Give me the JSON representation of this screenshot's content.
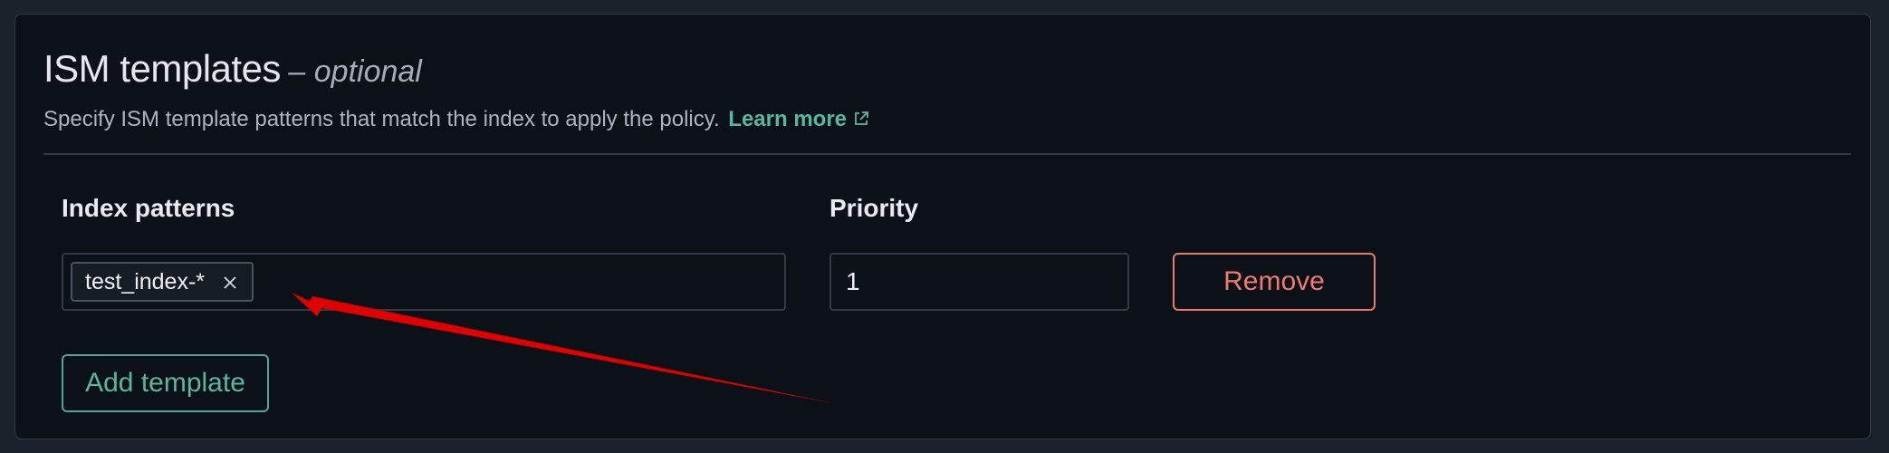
{
  "section": {
    "title": "ISM templates",
    "optional": "– optional",
    "description": "Specify ISM template patterns that match the index to apply the policy.",
    "learn_more": "Learn more",
    "learn_more_icon": "external-link-icon"
  },
  "form": {
    "index_patterns_label": "Index patterns",
    "priority_label": "Priority",
    "index_patterns": [
      "test_index-*"
    ],
    "priority_value": "1",
    "remove_label": "Remove",
    "add_template_label": "Add template"
  },
  "annotation": {
    "arrow_color": "#e00000"
  },
  "colors": {
    "accent": "#57b7a0",
    "danger": "#ef7b6f",
    "panel_bg": "#0c1017",
    "page_bg": "#1b222b"
  }
}
